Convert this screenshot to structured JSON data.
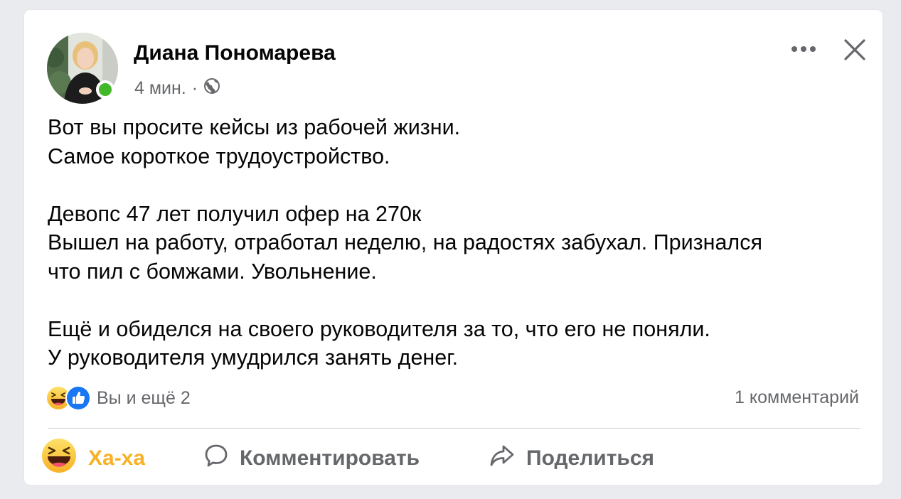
{
  "post": {
    "author": "Диана Пономарева",
    "time": "4 мин.",
    "separator": "·",
    "privacy_icon": "globe-icon",
    "paragraphs": [
      [
        "Вот вы просите кейсы из рабочей жизни.",
        "Самое короткое трудоустройство."
      ],
      [
        "Девопс 47 лет получил офер на 270к",
        "Вышел на работу, отработал неделю, на радостях забухал. Признался",
        "что пил с бомжами. Увольнение."
      ],
      [
        "Ещё и обиделся на своего руководителя за то, что его не поняли.",
        "У руководителя умудрился занять денег."
      ]
    ]
  },
  "reactions": {
    "icons": [
      "haha-icon",
      "like-icon"
    ],
    "summary": "Вы и ещё 2",
    "comments": "1 комментарий"
  },
  "actions": {
    "haha": "Ха-ха",
    "comment": "Комментировать",
    "share": "Поделиться"
  },
  "colors": {
    "online": "#42b72a",
    "haha_accent": "#f7b125",
    "like_blue": "#1877f2",
    "secondary_text": "#65676b"
  }
}
